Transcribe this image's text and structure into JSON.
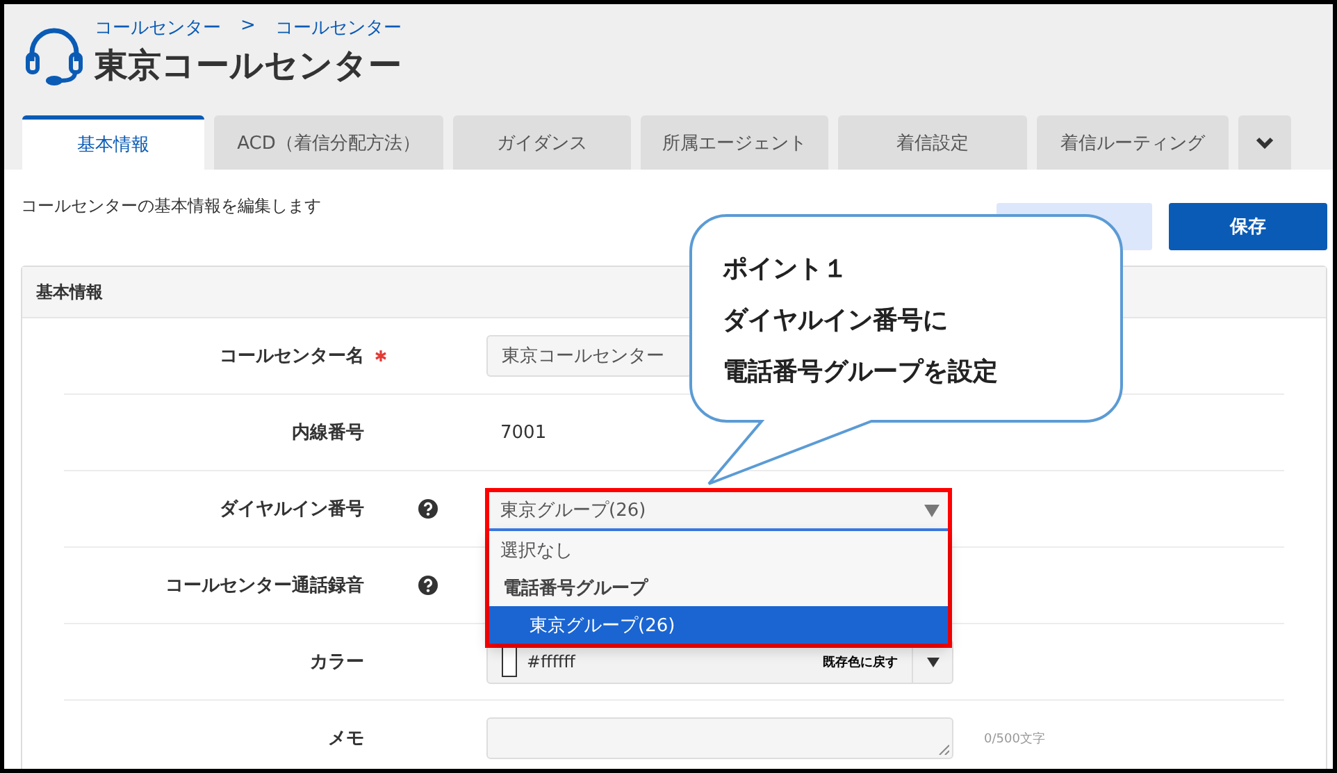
{
  "header": {
    "breadcrumb": [
      "コールセンター",
      "コールセンター"
    ],
    "breadcrumb_separator": ">",
    "title": "東京コールセンター"
  },
  "tabs": [
    {
      "kind": "text",
      "label": "基本情報",
      "selected": true
    },
    {
      "kind": "text",
      "label": "ACD（着信分配方法）",
      "selected": false
    },
    {
      "kind": "text",
      "label": "ガイダンス",
      "selected": false
    },
    {
      "kind": "text",
      "label": "所属エージェント",
      "selected": false
    },
    {
      "kind": "text",
      "label": "着信設定",
      "selected": false
    },
    {
      "kind": "text",
      "label": "着信ルーティング",
      "selected": false
    },
    {
      "kind": "more",
      "selected": false
    }
  ],
  "description": "コールセンターの基本情報を編集します",
  "actions": [
    {
      "kind": "secondary"
    },
    {
      "kind": "primary",
      "label": "保存"
    }
  ],
  "panel": {
    "title": "基本情報",
    "fields": [
      {
        "kind": "text",
        "label": "コールセンター名",
        "required": true,
        "value": "東京コールセンター"
      },
      {
        "kind": "static",
        "label": "内線番号",
        "value": "7001"
      },
      {
        "kind": "select",
        "label": "ダイヤルイン番号",
        "help": true,
        "value": "東京グループ(26)",
        "expanded": true,
        "highlighted": true,
        "options": [
          {
            "kind": "option",
            "label": "選択なし",
            "selected": false
          },
          {
            "kind": "group",
            "label": "電話番号グループ"
          },
          {
            "kind": "option",
            "label": "東京グループ(26)",
            "selected": true
          }
        ]
      },
      {
        "kind": "hidden",
        "label": "コールセンター通話録音",
        "help": true
      },
      {
        "kind": "color",
        "label": "カラー",
        "value": "#ffffff",
        "reset": "既存色に戻す"
      },
      {
        "kind": "textarea",
        "label": "メモ",
        "counter": "0/500文字"
      }
    ]
  },
  "callout": {
    "lines": [
      "ポイント１",
      "ダイヤルイン番号に",
      "電話番号グループを設定"
    ]
  }
}
